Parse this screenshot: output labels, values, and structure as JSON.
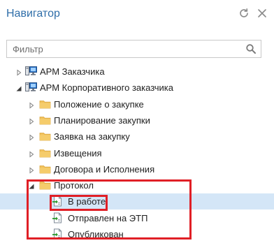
{
  "header": {
    "title": "Навигатор",
    "refresh_icon": "refresh-icon",
    "close_icon": "close-icon"
  },
  "filter": {
    "placeholder": "Фильтр",
    "value": "",
    "icon": "search-icon"
  },
  "tree": {
    "items": [
      {
        "label": "АРМ Заказчика",
        "level": 0,
        "icon": "workstation-icon",
        "expanded": false
      },
      {
        "label": "АРМ Корпоративного заказчика",
        "level": 0,
        "icon": "workstation-icon",
        "expanded": true
      },
      {
        "label": "Положение о закупке",
        "level": 1,
        "icon": "folder-icon",
        "expanded": false
      },
      {
        "label": "Планирование закупки",
        "level": 1,
        "icon": "folder-icon",
        "expanded": false
      },
      {
        "label": "Заявка на закупку",
        "level": 1,
        "icon": "folder-icon",
        "expanded": false
      },
      {
        "label": "Извещения",
        "level": 1,
        "icon": "folder-icon",
        "expanded": false
      },
      {
        "label": "Договора и Исполнения",
        "level": 1,
        "icon": "folder-icon",
        "expanded": false
      },
      {
        "label": "Протокол",
        "level": 1,
        "icon": "folder-icon",
        "expanded": true
      },
      {
        "label": "В работе",
        "level": 2,
        "icon": "document-arrow-icon",
        "selected": true
      },
      {
        "label": "Отправлен на ЭТП",
        "level": 2,
        "icon": "document-arrow-icon"
      },
      {
        "label": "Опубликован",
        "level": 2,
        "icon": "document-arrow-icon"
      }
    ]
  },
  "colors": {
    "title": "#2f6ea9",
    "selection": "#d4e6f7",
    "highlight": "#e01f26",
    "folder": "#f2c25c"
  }
}
